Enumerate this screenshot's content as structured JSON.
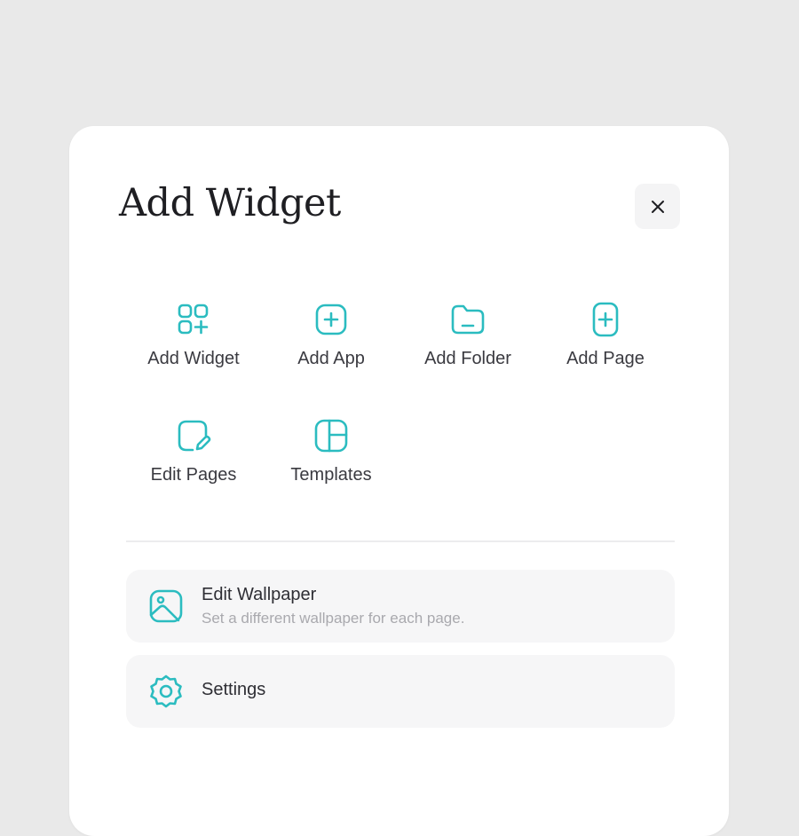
{
  "header": {
    "title": "Add Widget",
    "close_icon": "close-icon"
  },
  "accent_color": "#2bbcc0",
  "actions": [
    {
      "label": "Add Widget",
      "icon": "widgets-grid-plus-icon"
    },
    {
      "label": "Add App",
      "icon": "add-square-icon"
    },
    {
      "label": "Add Folder",
      "icon": "folder-icon"
    },
    {
      "label": "Add Page",
      "icon": "add-page-icon"
    },
    {
      "label": "Edit Pages",
      "icon": "edit-page-icon"
    },
    {
      "label": "Templates",
      "icon": "templates-layout-icon"
    }
  ],
  "rows": [
    {
      "title": "Edit Wallpaper",
      "subtitle": "Set a different wallpaper for each page.",
      "icon": "image-icon"
    },
    {
      "title": "Settings",
      "subtitle": "",
      "icon": "gear-icon"
    }
  ]
}
